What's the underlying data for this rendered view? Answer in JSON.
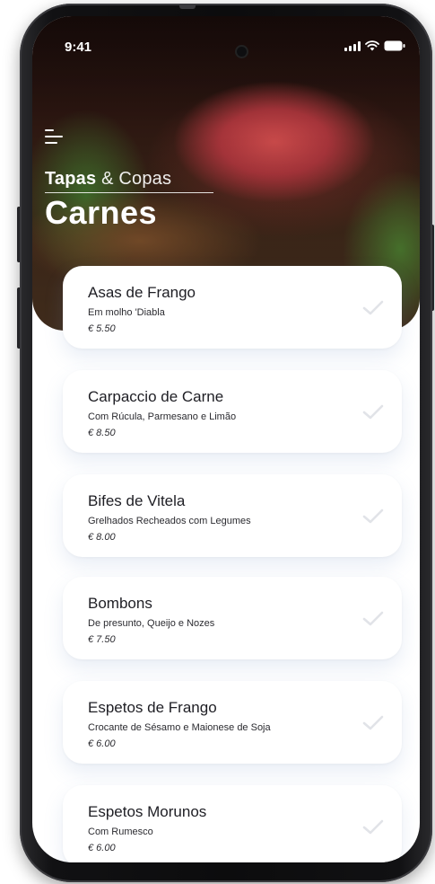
{
  "status_bar": {
    "time": "9:41"
  },
  "header": {
    "brand_primary": "Tapas",
    "brand_secondary": " & Copas",
    "category_title": "Carnes"
  },
  "colors": {
    "card_text": "#1e1e24",
    "check_mark": "#e1e3e8",
    "header_text": "#ffffff"
  },
  "menu_items": [
    {
      "name": "Asas de Frango",
      "description": "Em molho 'Diabla",
      "price": "€ 5.50"
    },
    {
      "name": "Carpaccio de Carne",
      "description": "Com Rúcula, Parmesano e Limão",
      "price": "€ 8.50"
    },
    {
      "name": "Bifes de Vitela",
      "description": "Grelhados Recheados com Legumes",
      "price": "€ 8.00"
    },
    {
      "name": "Bombons",
      "description": "De presunto, Queijo e Nozes",
      "price": "€ 7.50"
    },
    {
      "name": "Espetos de Frango",
      "description": "Crocante de Sésamo e Maionese de Soja",
      "price": "€ 6.00"
    },
    {
      "name": "Espetos Morunos",
      "description": "Com Rumesco",
      "price": "€ 6.00"
    }
  ]
}
